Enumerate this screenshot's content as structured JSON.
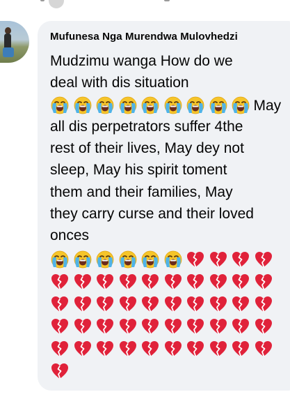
{
  "comment": {
    "author": "Mufunesa Nga Murendwa Mulovhedzi",
    "lines": [
      "Mudzimu wanga How do we",
      "deal with dis situation"
    ],
    "crying_run_1_count": 9,
    "after_run_1": "May",
    "lines_2": [
      "all dis perpetrators suffer 4the",
      "rest of their lives, May dey not",
      "sleep, May his spirit toment",
      "them and their families, May",
      "they carry curse and their loved",
      "onces"
    ],
    "crying_run_2_count": 6,
    "broken_hearts_count": 45
  },
  "icons": {
    "crying": "loudly-crying-face-icon",
    "heart": "broken-heart-icon"
  },
  "colors": {
    "bubble": "#f0f2f5",
    "text": "#050505",
    "heart": "#e0223a",
    "face": "#f6c52a",
    "tears": "#4fb3e8"
  }
}
